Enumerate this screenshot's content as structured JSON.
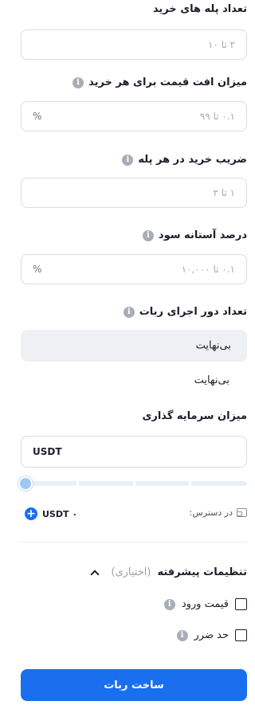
{
  "fields": {
    "grid_steps": {
      "label": "تعداد پله های خرید",
      "placeholder": "۲ تا ۱۰"
    },
    "price_drop": {
      "label": "میزان افت قیمت برای هر خرید",
      "placeholder": "۰.۱ تا ۹۹",
      "suffix": "%"
    },
    "buy_multiplier": {
      "label": "ضریب خرید در هر پله",
      "placeholder": "۱ تا ۲"
    },
    "profit_threshold": {
      "label": "درصد آستانه سود",
      "placeholder": "۰.۱ تا ۱۰,۰۰۰",
      "suffix": "%"
    },
    "run_cycles": {
      "label": "تعداد دور اجرای ربات",
      "selected": "بی‌نهایت",
      "option": "بی‌نهایت"
    },
    "investment": {
      "label": "میزان سرمایه گذاری",
      "value": "USDT"
    }
  },
  "slider": {
    "value_percent": 0
  },
  "balance": {
    "available_label": "در دسترس:",
    "amount": "USDT ۰"
  },
  "advanced": {
    "title": "تنظیمات پیشرفته",
    "optional": "(اختیاری)",
    "entry_price": "قیمت ورود",
    "stop_loss": "حد ضرر"
  },
  "submit_label": "ساخت ربات",
  "info_glyph": "i",
  "plus_glyph": "+",
  "colors": {
    "accent": "#1a6fef",
    "muted": "#a3a8b1"
  }
}
